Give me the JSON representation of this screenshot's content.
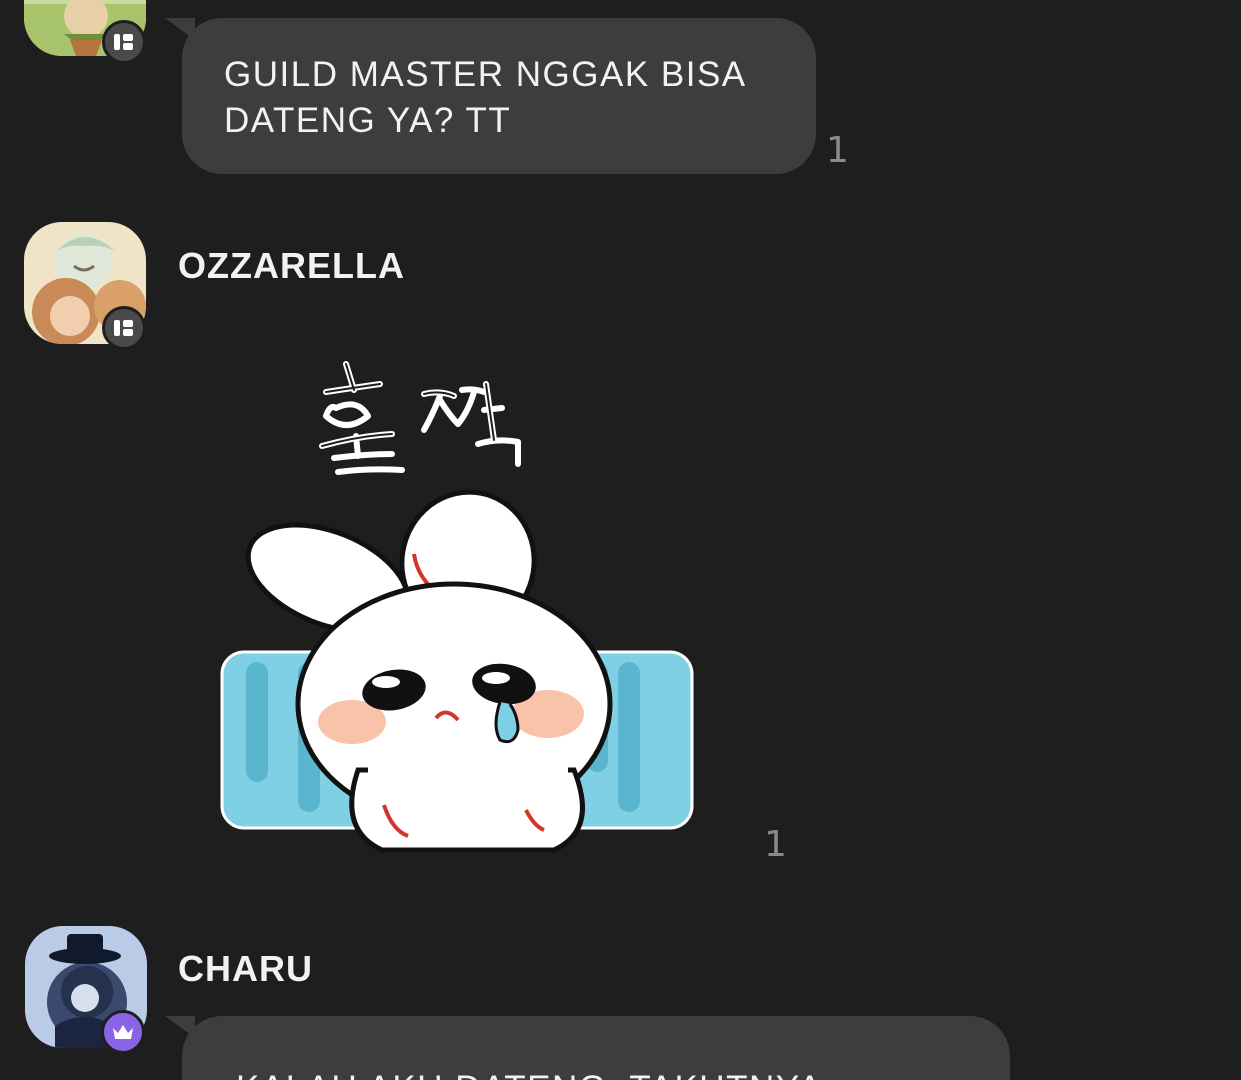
{
  "chat": {
    "messages": [
      {
        "sender": "",
        "lines": [
          "GUILD MASTER NGGAK BISA",
          "DATENG YA? TT"
        ],
        "unread": "1"
      },
      {
        "sender": "OZZARELLA",
        "sticker": {
          "caption": "울 쩍",
          "description": "crying white bunny sticker"
        },
        "unread": "1"
      },
      {
        "sender": "CHARU",
        "lines": [
          "KALAU AKU DATENG, TAKUTNYA"
        ],
        "unread": ""
      }
    ]
  },
  "colors": {
    "background": "#1e1e1e",
    "bubble": "#3d3d3d",
    "text": "#f2f2f2",
    "unread": "#8a8a8a",
    "host_badge": "#4a4a4a",
    "crown_badge": "#8a63e6"
  }
}
